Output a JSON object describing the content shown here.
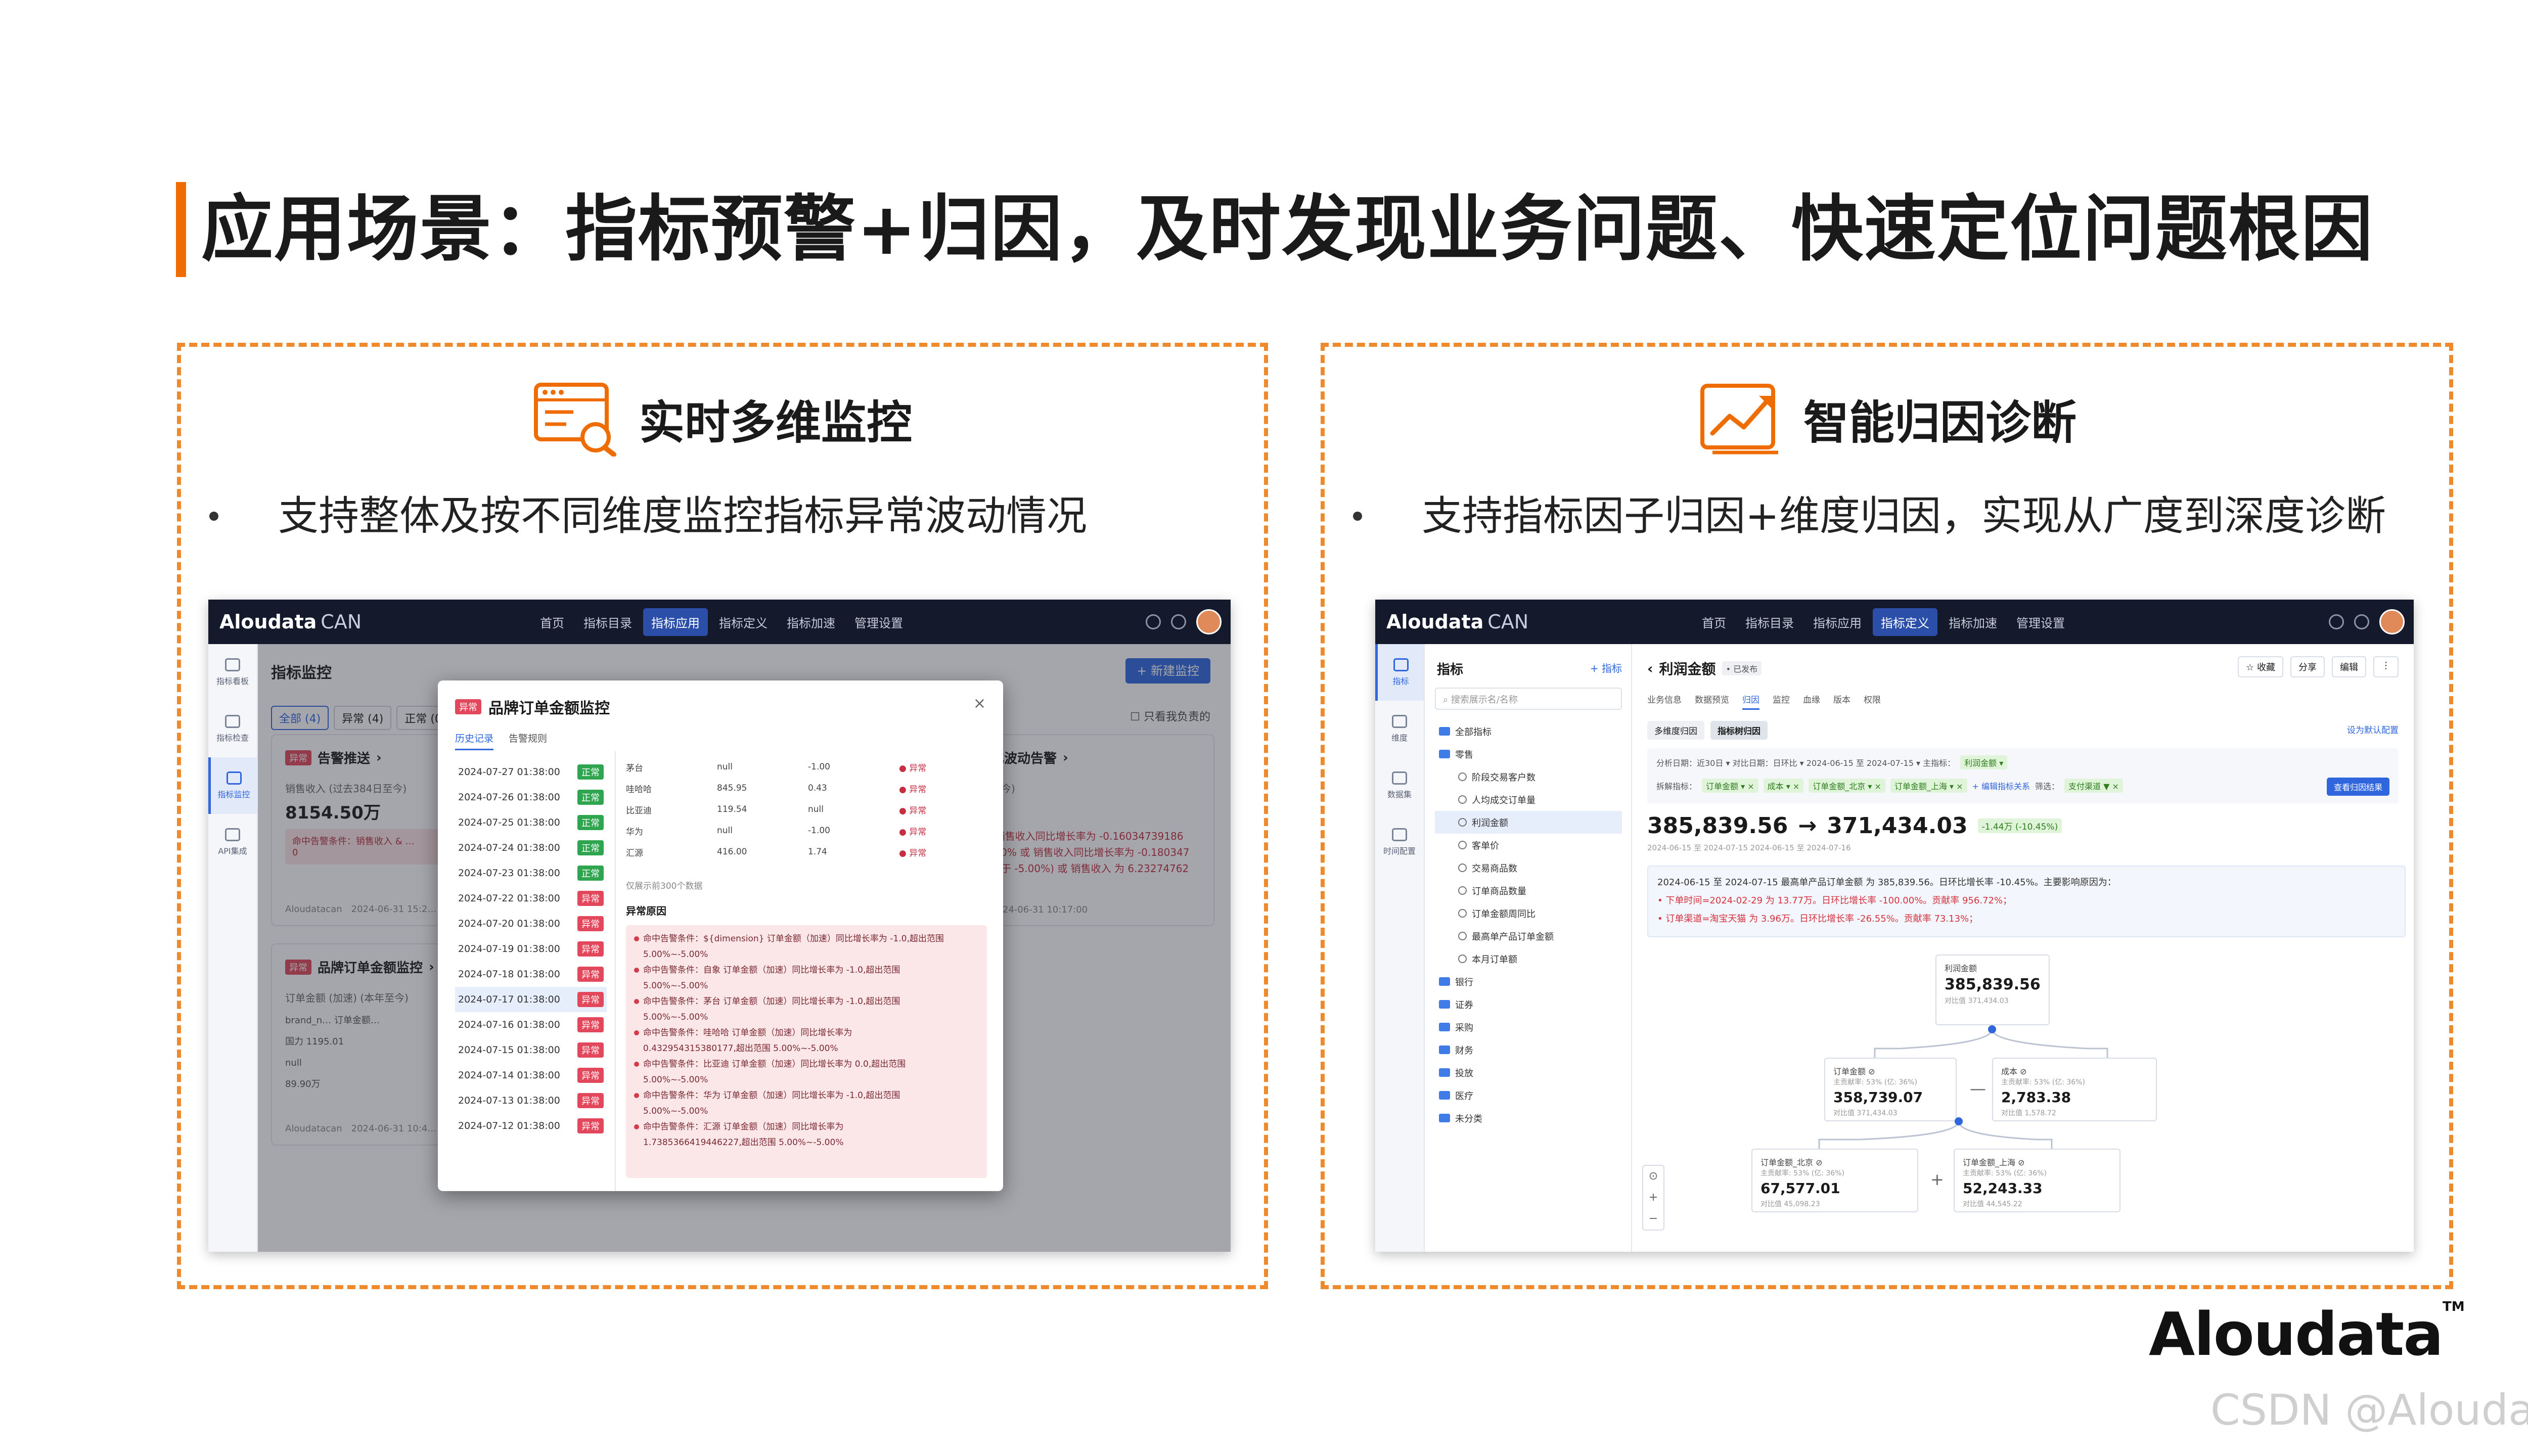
{
  "slide": {
    "title": "应用场景：指标预警+归因，及时发现业务问题、快速定位问题根因",
    "accent_color": "#ef6c00",
    "dash_color": "#ef8a2c"
  },
  "left_panel": {
    "heading": "实时多维监控",
    "icon": "monitor-screen-icon",
    "bullet": "支持整体及按不同维度监控指标异常波动情况"
  },
  "right_panel": {
    "heading": "智能归因诊断",
    "icon": "trend-chart-icon",
    "bullet": "支持指标因子归因+维度归因，实现从广度到深度诊断"
  },
  "app_common": {
    "logo": "Aloudata",
    "logo_suffix": "CAN",
    "nav": [
      "首页",
      "指标目录",
      "指标应用",
      "指标定义",
      "指标加速",
      "管理设置"
    ]
  },
  "left_app": {
    "sidebar": [
      "指标看板",
      "指标检查",
      "指标监控",
      "API集成"
    ],
    "page_title": "指标监控",
    "new_button": "+ 新建监控",
    "filters": [
      "全部 (4)",
      "异常 (4)",
      "正常 (0)"
    ],
    "only_mine": "只看我负责的",
    "card1": {
      "tag": "异常",
      "title": "告警推送",
      "sub": "销售收入 (过去384日至今)",
      "value": "8154.50万",
      "alert": "命中告警条件：销售收入 & …",
      "alert_value": "0",
      "foot_user": "Aloudatacan",
      "foot_time": "2024-06-31 15:2…"
    },
    "card2": {
      "tag": "异常",
      "title": "品牌订单金额监控",
      "sub": "订单金额 (加速) (本年至今)",
      "rows": [
        "brand_n…   订单金额…",
        "国力        1195.01",
        "              null",
        "              89.90万"
      ],
      "foot_user": "Aloudatacan",
      "foot_time": "2024-06-31 10:4…"
    },
    "card3": {
      "title": "化波动告警",
      "sub": "至今)",
      "lines": [
        "(销售收入同比增长率为 -0.16034739186",
        ".00% 或 销售收入同比增长率为 -0.180347",
        "小于 -5.00%) 或 销售收入 为 6.23274762"
      ],
      "foot": "2024-06-31 10:17:00"
    },
    "modal": {
      "tag": "异常",
      "title": "品牌订单金额监控",
      "close": "×",
      "tabs": [
        "历史记录",
        "告警规则"
      ],
      "history": [
        {
          "time": "2024-07-27 01:38:00",
          "status": "正常",
          "ok": true
        },
        {
          "time": "2024-07-26 01:38:00",
          "status": "正常",
          "ok": true
        },
        {
          "time": "2024-07-25 01:38:00",
          "status": "正常",
          "ok": true
        },
        {
          "time": "2024-07-24 01:38:00",
          "status": "正常",
          "ok": true
        },
        {
          "time": "2024-07-23 01:38:00",
          "status": "正常",
          "ok": true
        },
        {
          "time": "2024-07-22 01:38:00",
          "status": "异常",
          "ok": false
        },
        {
          "time": "2024-07-20 01:38:00",
          "status": "异常",
          "ok": false
        },
        {
          "time": "2024-07-19 01:38:00",
          "status": "异常",
          "ok": false
        },
        {
          "time": "2024-07-18 01:38:00",
          "status": "异常",
          "ok": false
        },
        {
          "time": "2024-07-17 01:38:00",
          "status": "异常",
          "ok": false
        },
        {
          "time": "2024-07-16 01:38:00",
          "status": "异常",
          "ok": false
        },
        {
          "time": "2024-07-15 01:38:00",
          "status": "异常",
          "ok": false
        },
        {
          "time": "2024-07-14 01:38:00",
          "status": "异常",
          "ok": false
        },
        {
          "time": "2024-07-13 01:38:00",
          "status": "异常",
          "ok": false
        },
        {
          "time": "2024-07-12 01:38:00",
          "status": "异常",
          "ok": false
        }
      ],
      "table": [
        {
          "name": "茅台",
          "a": "null",
          "b": "-1.00",
          "status": "异常"
        },
        {
          "name": "哇哈哈",
          "a": "845.95",
          "b": "0.43",
          "status": "异常"
        },
        {
          "name": "比亚迪",
          "a": "119.54",
          "b": "null",
          "status": "异常"
        },
        {
          "name": "华为",
          "a": "null",
          "b": "-1.00",
          "status": "异常"
        },
        {
          "name": "汇源",
          "a": "416.00",
          "b": "1.74",
          "status": "异常"
        }
      ],
      "note": "仅展示前300个数据",
      "reason_title": "异常原因",
      "reasons": [
        "命中告警条件：${dimension} 订单金额（加速）同比增长率为 -1.0,超出范围",
        "5.00%~-5.00%",
        "命中告警条件：自象 订单金额（加速）同比增长率为 -1.0,超出范围",
        "5.00%~-5.00%",
        "命中告警条件：茅台 订单金额（加速）同比增长率为 -1.0,超出范围",
        "5.00%~-5.00%",
        "命中告警条件：哇哈哈 订单金额（加速）同比增长率为",
        "0.43295431538017​7,超出范围 5.00%~-5.00%",
        "命中告警条件：比亚迪 订单金额（加速）同比增长率为 0.0,超出范围",
        "5.00%~-5.00%",
        "命中告警条件：华为 订单金额（加速）同比增长率为 -1.0,超出范围",
        "5.00%~-5.00%",
        "命中告警条件：汇源 订单金额（加速）同比增长率为",
        "1.738536641944​6227,超出范围 5.00%~-5.00%"
      ]
    }
  },
  "right_app": {
    "sidebar": [
      "指标",
      "维度",
      "数据集",
      "时间配置"
    ],
    "tree_title": "指标",
    "tree_add": "+ 指标",
    "search_placeholder": "搜索展示名/名称",
    "tree": [
      {
        "label": "全部指标",
        "type": "folder",
        "indent": 0
      },
      {
        "label": "零售",
        "type": "folder",
        "indent": 0
      },
      {
        "label": "阶段交易客户数",
        "type": "metric",
        "indent": 1
      },
      {
        "label": "人均成交订单量",
        "type": "metric",
        "indent": 1
      },
      {
        "label": "利润金额",
        "type": "metric",
        "indent": 1,
        "selected": true
      },
      {
        "label": "客单价",
        "type": "metric",
        "indent": 1
      },
      {
        "label": "交易商品数",
        "type": "metric",
        "indent": 1
      },
      {
        "label": "订单商品数量",
        "type": "metric",
        "indent": 1
      },
      {
        "label": "订单金额周同比",
        "type": "metric",
        "indent": 1
      },
      {
        "label": "最高单产品订单金额",
        "type": "metric",
        "indent": 1
      },
      {
        "label": "本月订单额",
        "type": "metric",
        "indent": 1
      },
      {
        "label": "银行",
        "type": "folder",
        "indent": 0
      },
      {
        "label": "证券",
        "type": "folder",
        "indent": 0
      },
      {
        "label": "采购",
        "type": "folder",
        "indent": 0
      },
      {
        "label": "财务",
        "type": "folder",
        "indent": 0
      },
      {
        "label": "投放",
        "type": "folder",
        "indent": 0
      },
      {
        "label": "医疗",
        "type": "folder",
        "indent": 0
      },
      {
        "label": "未分类",
        "type": "folder",
        "indent": 0
      }
    ],
    "detail_title": "利润金额",
    "published": "• 已发布",
    "actions": [
      "☆ 收藏",
      "分享",
      "编辑",
      "⋮"
    ],
    "tabs": [
      "业务信息",
      "数据预览",
      "归因",
      "监控",
      "血缘",
      "版本",
      "权限"
    ],
    "subtabs": [
      "多维度归因",
      "指标树归因"
    ],
    "default_config": "设为默认配置",
    "filter_line1": "分析日期：近30日  ▾    对比日期：日环比  ▾  2024-06-15 至 2024-07-15  ▾    主指标：",
    "main_metric": "利润金额 ▾",
    "filter_line2": "拆解指标：",
    "chips": [
      "订单金额 ▾ ×",
      "成本 ▾ ×",
      "订单金额_北京 ▾ ×",
      "订单金额_上海 ▾ ×"
    ],
    "edit_rel": "+   编辑指标关系",
    "filter_word": "筛选：",
    "filter_chip": "支付渠道 ▼ ×",
    "view_button": "查看归因结果",
    "value_from": "385,839.56",
    "value_to": "371,434.03",
    "change": "-1.44万 (-10.45%)",
    "dates": "2024-06-15 至 2024-07-15              2024-06-15 至 2024-07-16",
    "summary": [
      "2024-06-15 至 2024-07-15 最高单产品订单金额 为 385,839.56。日环比增长率 -10.45%。主要影响原因为：",
      "• 下单时间=2024-02-29 为 13.77万。日环比增长率 -100.00%。贡献率 956.72%；",
      "• 订单渠道=淘宝天猫 为 3.96万。日环比增长率 -26.55%。贡献率 73.13%；"
    ],
    "nodes": {
      "root": {
        "name": "利润金额",
        "value": "385,839.56",
        "cmp": "对比值  371,434.03"
      },
      "n1": {
        "name": "订单金额  ⊘",
        "meta": "主贡献率: 53%  (亿: 36%)",
        "value": "358,739.07",
        "cmp": "对比值  371,434.03"
      },
      "n2": {
        "name": "成本  ⊘",
        "meta": "主贡献率: 53%  (亿: 36%)",
        "value": "2,783.38",
        "cmp": "对比值  1,578.72"
      },
      "n3": {
        "name": "订单金额_北京  ⊘",
        "meta": "主贡献率: 53%  (亿: 36%)",
        "value": "67,577.01",
        "cmp": "对比值  45,098.23"
      },
      "n4": {
        "name": "订单金额_上海  ⊘",
        "meta": "主贡献率: 53%  (亿: 36%)",
        "value": "52,243.33",
        "cmp": "对比值  44,545.22"
      }
    },
    "ops": [
      "—",
      "+"
    ],
    "zoom": [
      "⊙",
      "+",
      "−"
    ]
  },
  "brand": {
    "name": "Aloudata",
    "tm": "TM"
  },
  "watermark": "CSDN @Aloudata"
}
